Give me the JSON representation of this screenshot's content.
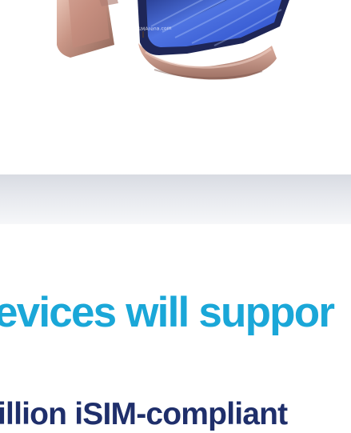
{
  "hero": {
    "watermark": "www.GSMArena.com",
    "phone_colors": {
      "body": "#c99888",
      "body_shadow": "#9a6e62",
      "screen_dark": "#1a2b6e",
      "screen_mid": "#4666d8",
      "screen_light": "#8fb0ff"
    },
    "phone_icon": "foldable-phone-icon"
  },
  "article": {
    "headline": "evices will suppor",
    "subheadline": "illion iSIM-compliant"
  },
  "colors": {
    "headline": "#1aa7d8",
    "subheadline": "#1f2f6b",
    "band_top": "#d8dbe2",
    "band_bottom": "#f6f7f9"
  }
}
